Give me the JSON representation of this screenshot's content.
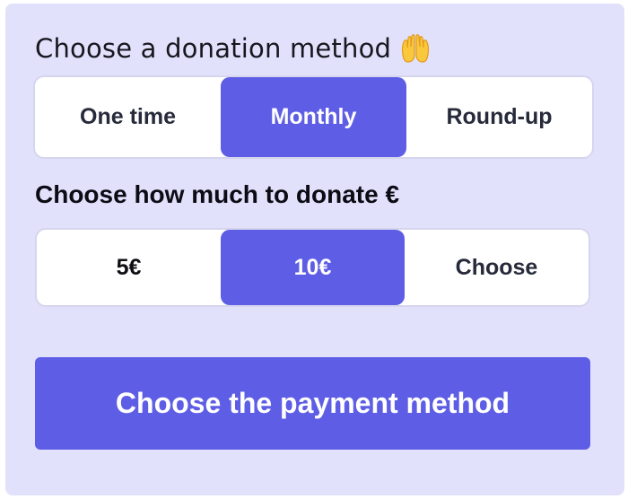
{
  "donation_method": {
    "title": "Choose a donation method",
    "title_icon": "raised-hands-icon",
    "options": [
      {
        "label": "One time",
        "selected": false
      },
      {
        "label": "Monthly",
        "selected": true
      },
      {
        "label": "Round-up",
        "selected": false
      }
    ]
  },
  "amount": {
    "title": "Choose how much to donate €",
    "options": [
      {
        "label": "5€",
        "selected": false
      },
      {
        "label": "10€",
        "selected": true
      },
      {
        "label": "Choose",
        "selected": false
      }
    ]
  },
  "cta": {
    "label": "Choose the payment method"
  },
  "colors": {
    "accent": "#5e5de5",
    "card_background": "#e2e1fc",
    "segment_background": "#ffffff",
    "text_dark": "#262a3a"
  }
}
